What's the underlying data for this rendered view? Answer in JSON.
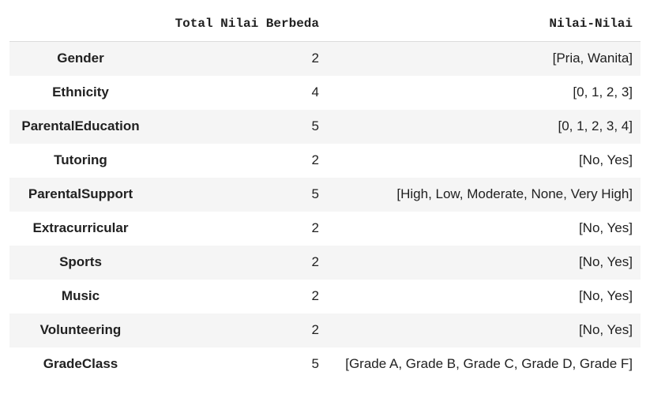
{
  "table": {
    "index_header": "",
    "columns": [
      "Total Nilai Berbeda",
      "Nilai-Nilai"
    ],
    "rows": [
      {
        "name": "Gender",
        "count": "2",
        "values": "[Pria, Wanita]"
      },
      {
        "name": "Ethnicity",
        "count": "4",
        "values": "[0, 1, 2, 3]"
      },
      {
        "name": "ParentalEducation",
        "count": "5",
        "values": "[0, 1, 2, 3, 4]"
      },
      {
        "name": "Tutoring",
        "count": "2",
        "values": "[No, Yes]"
      },
      {
        "name": "ParentalSupport",
        "count": "5",
        "values": "[High, Low, Moderate, None, Very High]"
      },
      {
        "name": "Extracurricular",
        "count": "2",
        "values": "[No, Yes]"
      },
      {
        "name": "Sports",
        "count": "2",
        "values": "[No, Yes]"
      },
      {
        "name": "Music",
        "count": "2",
        "values": "[No, Yes]"
      },
      {
        "name": "Volunteering",
        "count": "2",
        "values": "[No, Yes]"
      },
      {
        "name": "GradeClass",
        "count": "5",
        "values": "[Grade A, Grade B, Grade C, Grade D, Grade F]"
      }
    ]
  }
}
